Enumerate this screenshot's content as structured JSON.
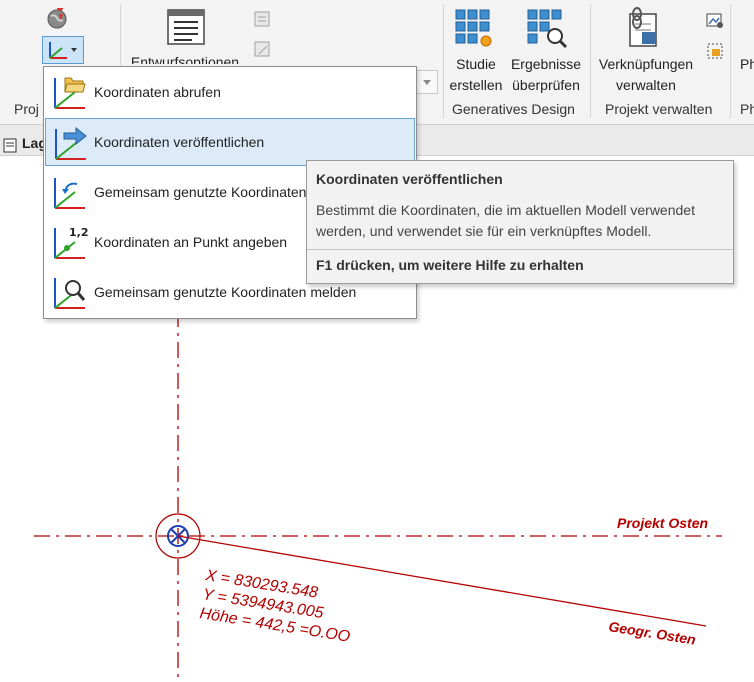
{
  "ribbon": {
    "project_panel_label": "Proj",
    "entwurfsoptionen_label": "Entwurfsoptionen",
    "studie_erstellen": [
      "Studie",
      "erstellen"
    ],
    "ergebnisse_ueberpruefen": [
      "Ergebnisse",
      "überprüfen"
    ],
    "verknuepfungen_verwalten": [
      "Verknüpfungen",
      "verwalten"
    ],
    "panel_generatives_design": "Generatives Design",
    "panel_projekt_verwalten": "Projekt verwalten",
    "cut_label_top": "Ph",
    "cut_label_bottom": "Ph"
  },
  "view_tab": {
    "label": "Lag"
  },
  "menu": {
    "items": [
      {
        "label": "Koordinaten abrufen",
        "icon": "folder-coordinates-icon"
      },
      {
        "label": "Koordinaten veröffentlichen",
        "icon": "publish-coordinates-icon",
        "highlighted": true
      },
      {
        "label": "Gemeinsam genutzte Koordinaten",
        "icon": "reset-coordinates-icon"
      },
      {
        "label": "Koordinaten an Punkt angeben",
        "icon": "point-coordinates-icon"
      },
      {
        "label": "Gemeinsam genutzte Koordinaten melden",
        "icon": "report-coordinates-icon"
      }
    ]
  },
  "tooltip": {
    "title": "Koordinaten veröffentlichen",
    "body_line1": "Bestimmt die Koordinaten, die im aktuellen Modell verwendet",
    "body_line2": "werden, und verwendet sie für ein verknüpftes Modell.",
    "help": "F1 drücken, um weitere Hilfe zu erhalten"
  },
  "drawing": {
    "projekt_osten": "Projekt Osten",
    "geogr_osten": "Geogr. Osten",
    "x_coord": "X = 830293.548",
    "y_coord": "Y = 5394943.005",
    "hoehe": "Höhe = 442,5 =O.OO",
    "line_color": "#b40000",
    "marker_color": "#1f3fb4"
  }
}
